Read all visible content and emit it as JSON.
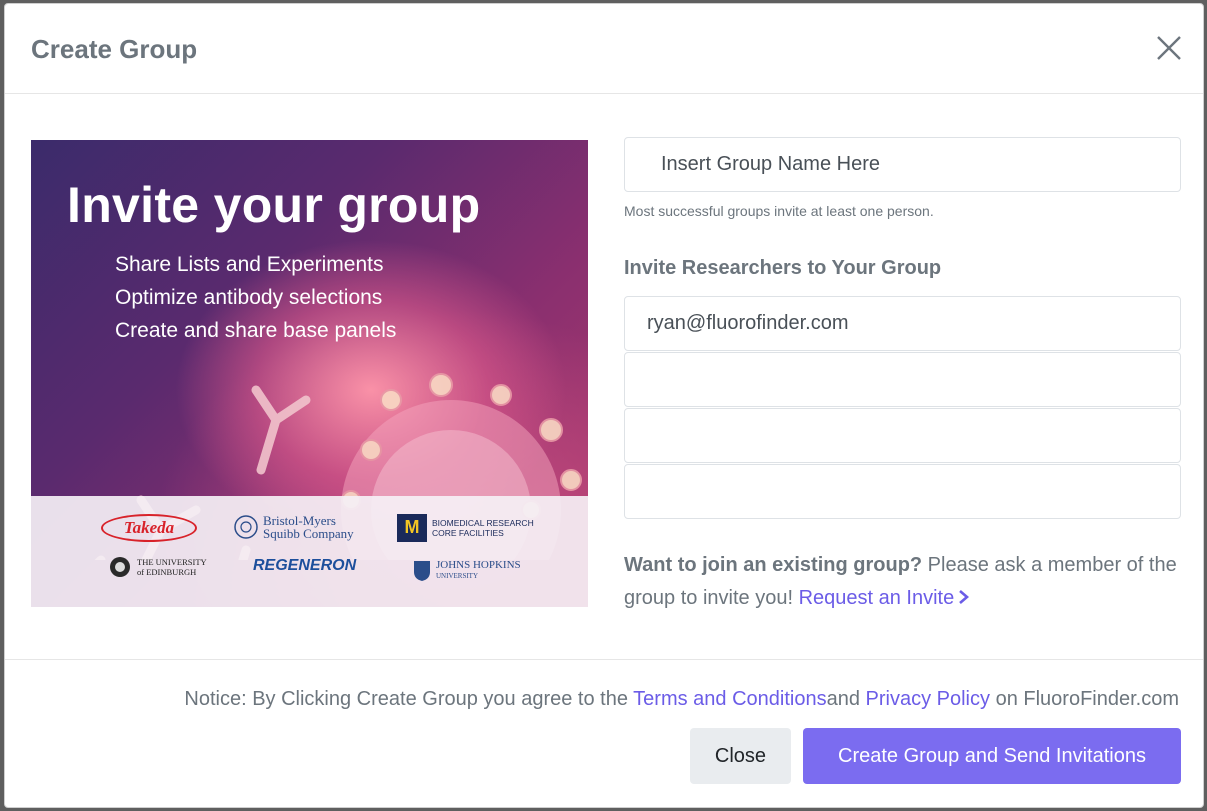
{
  "modal": {
    "title": "Create Group",
    "close_icon": "close-icon"
  },
  "promo": {
    "title": "Invite your group",
    "bullets": [
      "Share Lists and Experiments",
      "Optimize antibody selections",
      "Create and share base panels"
    ],
    "logos": {
      "takeda": "Takeda",
      "bms_line1": "Bristol-Myers",
      "bms_line2": "Squibb Company",
      "um_mark": "M",
      "um_line1": "BIOMEDICAL RESEARCH",
      "um_line2": "CORE FACILITIES",
      "edin_line1": "THE UNIVERSITY",
      "edin_line2": "of EDINBURGH",
      "regeneron": "REGENERON",
      "jh_line1": "JOHNS HOPKINS",
      "jh_line2": "UNIVERSITY"
    }
  },
  "form": {
    "group_name_value": "Insert Group Name Here",
    "hint": "Most successful groups invite at least one person.",
    "invite_title": "Invite Researchers to Your Group",
    "emails": [
      "ryan@fluorofinder.com",
      "",
      "",
      ""
    ],
    "join_bold": "Want to join an existing group?",
    "join_text": " Please ask a member of the group to invite you! ",
    "request_link": "Request an Invite"
  },
  "footer": {
    "notice_prefix": "Notice: By Clicking Create Group you agree to the ",
    "terms_link": "Terms and Conditions",
    "notice_and": "and ",
    "privacy_link": "Privacy Policy",
    "notice_suffix": " on FluoroFinder.com",
    "close_label": "Close",
    "create_label": "Create Group and Send Invitations"
  },
  "colors": {
    "accent": "#7b6cf0",
    "link": "#6b5ce7",
    "muted_text": "#6c757d"
  }
}
